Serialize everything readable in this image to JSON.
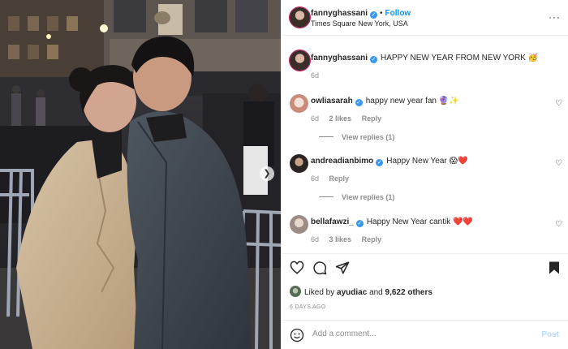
{
  "post": {
    "username": "fannyghassani",
    "follow_label": "Follow",
    "location": "Times Square New York, USA",
    "more_icon": "more-options-icon",
    "caption": {
      "username": "fannyghassani",
      "text": "HAPPY NEW YEAR FROM NEW YORK 🥳",
      "time": "6d"
    }
  },
  "comments": [
    {
      "username": "owliasarah",
      "text": "happy new year fan 🔮✨",
      "time": "6d",
      "likes": "2 likes",
      "reply_label": "Reply",
      "view_replies": "View replies (1)"
    },
    {
      "username": "andreadianbimo",
      "text": "Happy New Year 😱❤️",
      "time": "6d",
      "likes": "",
      "reply_label": "Reply",
      "view_replies": "View replies (1)"
    },
    {
      "username": "bellafawzi_",
      "text": "Happy New Year cantik ❤️❤️",
      "time": "6d",
      "likes": "3 likes",
      "reply_label": "Reply",
      "view_replies": ""
    }
  ],
  "likes": {
    "prefix": "Liked by",
    "user": "ayudiac",
    "conjunction": "and",
    "count": "9,622 others"
  },
  "time_ago": "6 DAYS AGO",
  "add_comment": {
    "placeholder": "Add a comment...",
    "post_label": "Post"
  },
  "colors": {
    "link_blue": "#0095f6",
    "verified_blue": "#3897f0",
    "muted": "#8e8e8e",
    "post_disabled": "#b3dbff"
  }
}
